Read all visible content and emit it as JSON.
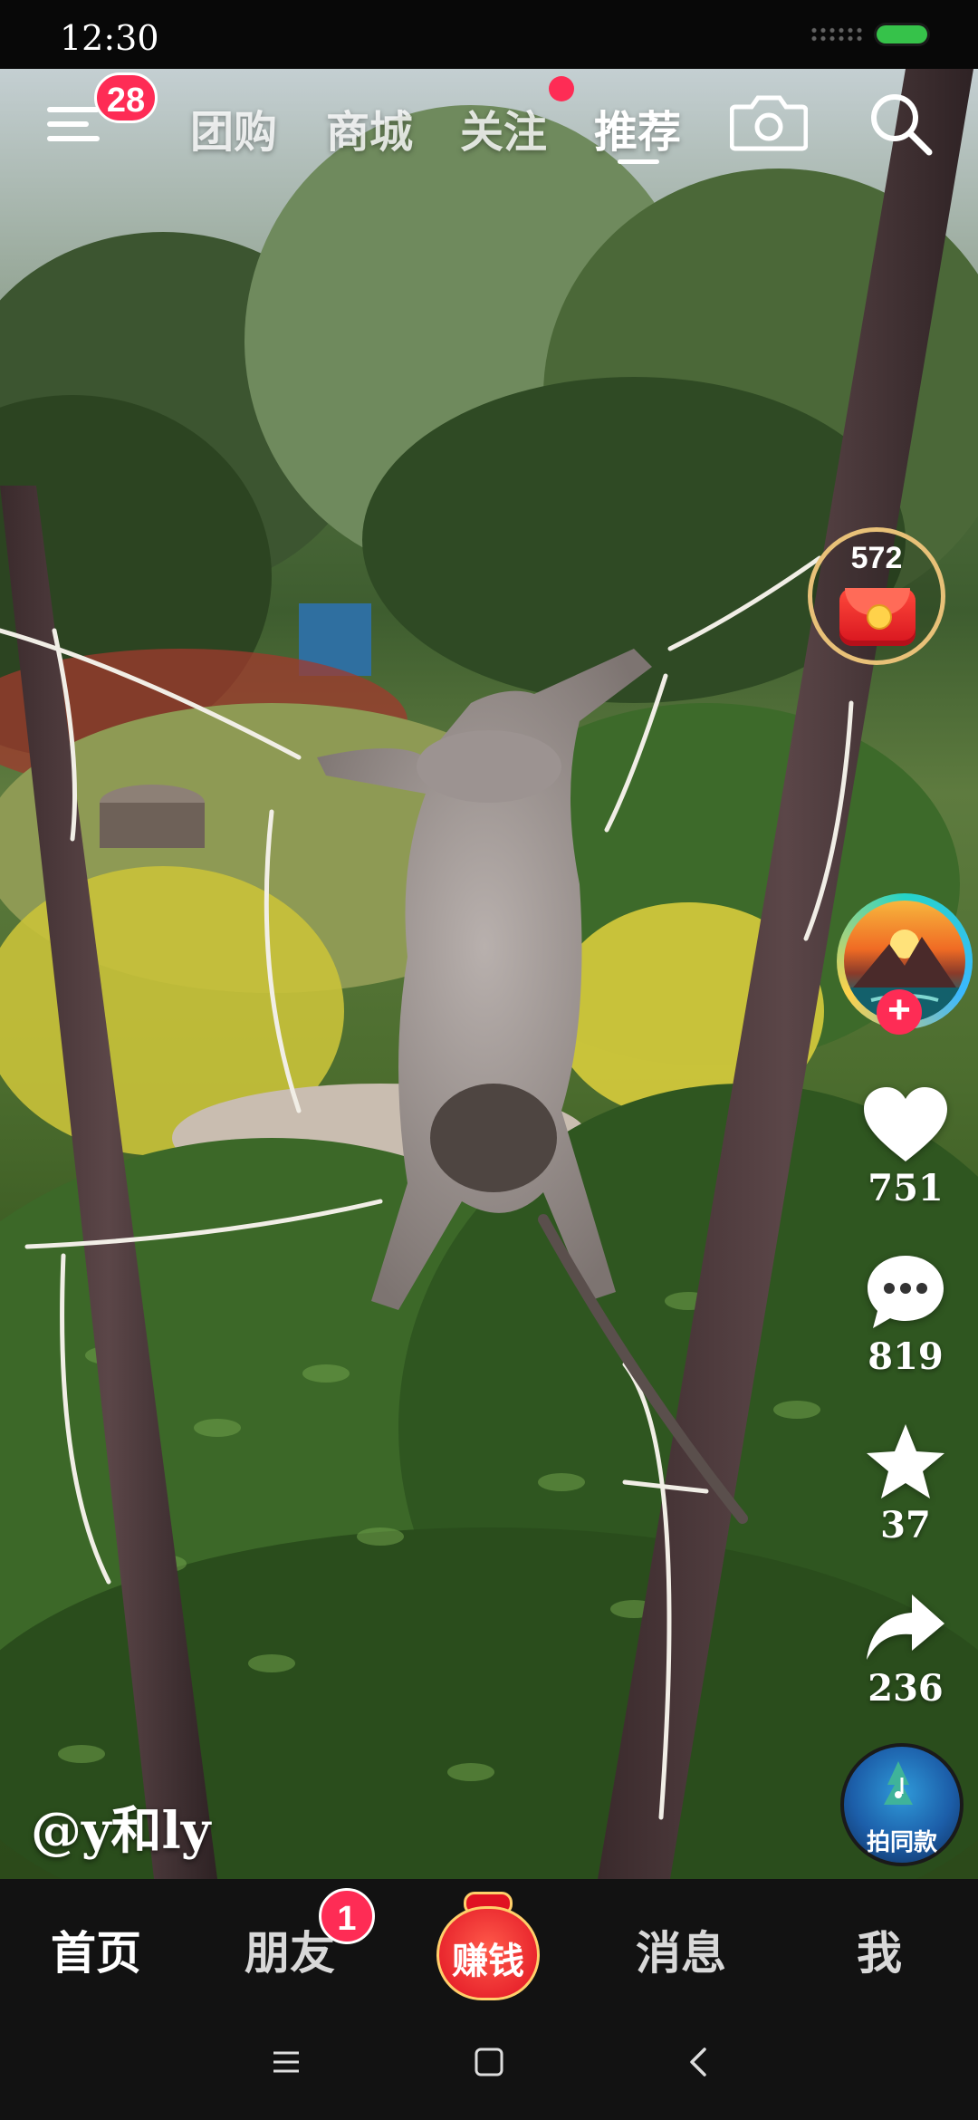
{
  "status_bar": {
    "time": "12:30"
  },
  "top_nav": {
    "menu_badge": "28",
    "tabs": [
      {
        "label": "团购"
      },
      {
        "label": "商城"
      },
      {
        "label": "关注"
      },
      {
        "label": "推荐",
        "active": true
      }
    ]
  },
  "right_rail": {
    "coin_count": "572",
    "likes": "751",
    "comments": "819",
    "favorites": "37",
    "shares": "236",
    "music_button": "拍同款"
  },
  "video": {
    "author_handle": "@y和ly"
  },
  "bottom_tabs": {
    "home": "首页",
    "friends": "朋友",
    "friends_badge": "1",
    "earn": "赚钱",
    "messages": "消息",
    "me": "我"
  },
  "colors": {
    "accent": "#fe2c55",
    "earn_red": "#e01222",
    "bar_bg": "#121212"
  },
  "icons": [
    "menu-icon",
    "camera-icon",
    "search-icon",
    "red-envelope-icon",
    "heart-icon",
    "comment-icon",
    "star-icon",
    "share-icon",
    "music-note-icon"
  ]
}
